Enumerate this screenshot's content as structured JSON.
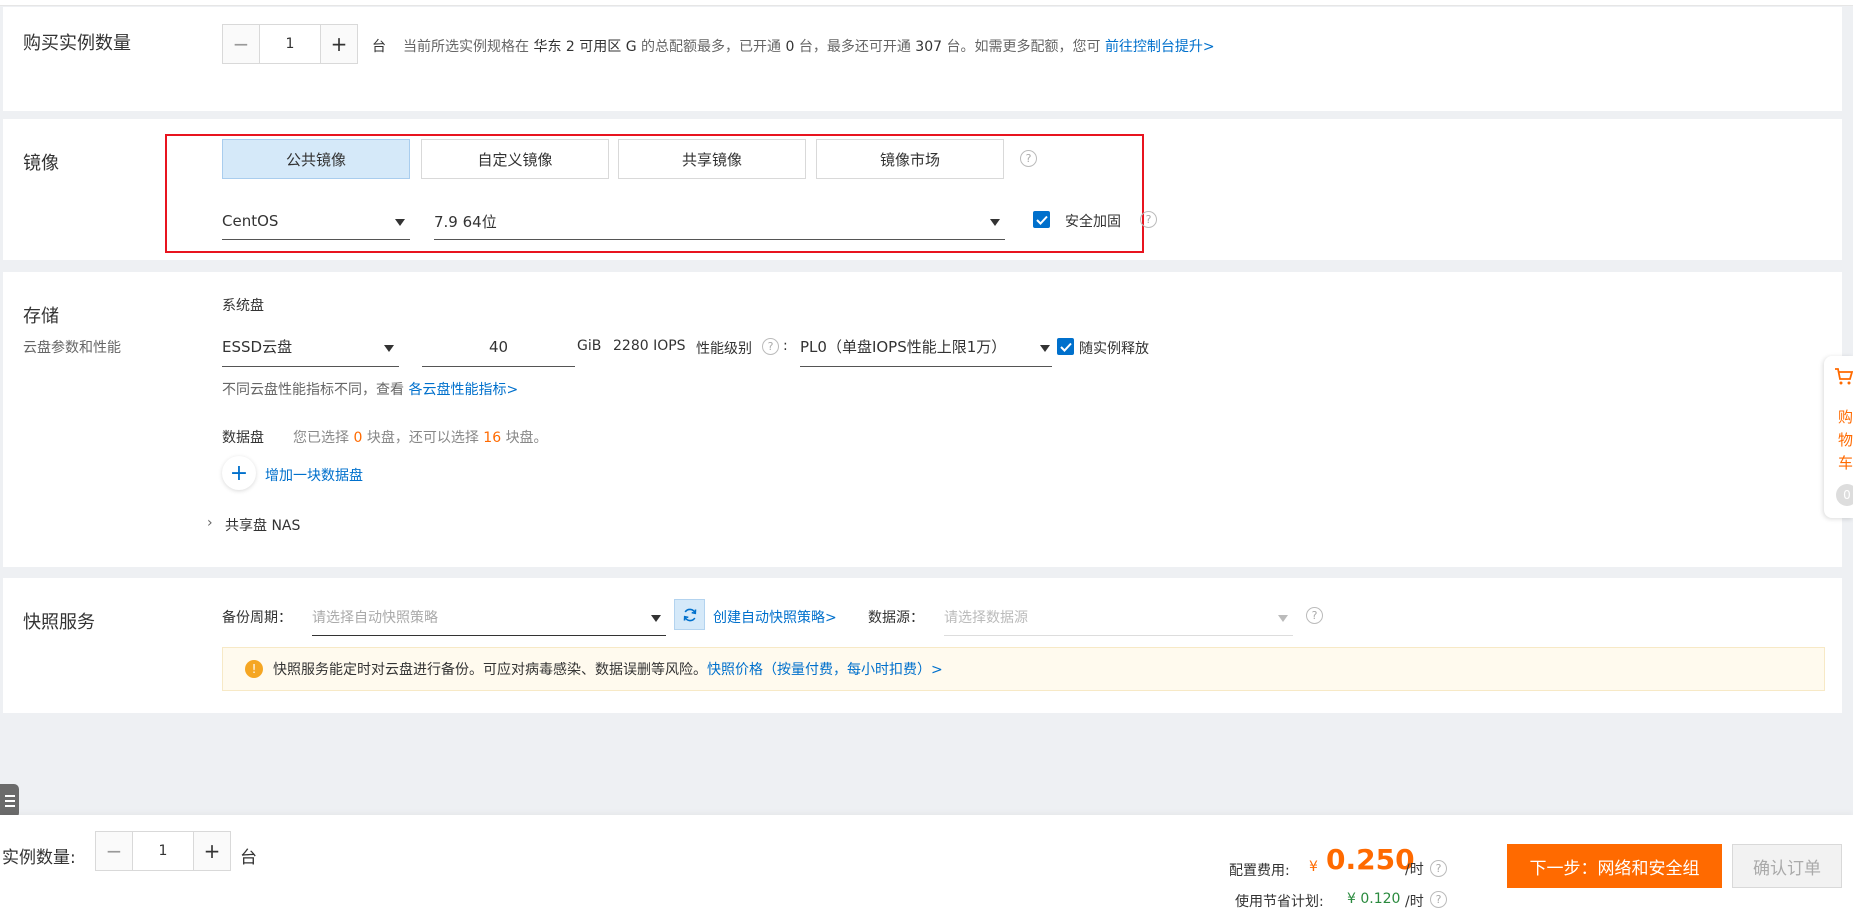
{
  "quantity_section": {
    "title": "购买实例数量",
    "value": "1",
    "unit": "台",
    "note_prefix": "当前所选实例规格在",
    "zone_strong": "华东 2 可用区 G",
    "note_middle": "的总配额最多，已开通",
    "opened": "0",
    "note_middle2": "台，最多还可开通",
    "remaining": "307",
    "note_suffix": "台。如需更多配额，您可",
    "link": "前往控制台提升>"
  },
  "image_section": {
    "title": "镜像",
    "tabs": [
      "公共镜像",
      "自定义镜像",
      "共享镜像",
      "镜像市场"
    ],
    "os": "CentOS",
    "version": "7.9 64位",
    "security_label": "安全加固"
  },
  "storage_section": {
    "title": "存储",
    "subtitle": "云盘参数和性能",
    "system_disk_label": "系统盘",
    "disk_type": "ESSD云盘",
    "disk_size": "40",
    "unit": "GiB",
    "iops": "2280 IOPS",
    "perf_level_label": "性能级别",
    "perf_level_colon": ":",
    "perf_level_value": "PL0（单盘IOPS性能上限1万）",
    "release_label": "随实例释放",
    "hint_text": "不同云盘性能指标不同，查看",
    "hint_link": "各云盘性能指标>",
    "data_disk_label": "数据盘",
    "data_note_1": "您已选择",
    "data_selected": "0",
    "data_note_2": "块盘，还可以选择",
    "data_remaining": "16",
    "data_note_3": "块盘。",
    "add_disk": "增加一块数据盘",
    "shared_nas": "共享盘 NAS"
  },
  "snapshot_section": {
    "title": "快照服务",
    "backup_label": "备份周期：",
    "backup_placeholder": "请选择自动快照策略",
    "create_link": "创建自动快照策略>",
    "source_label": "数据源：",
    "source_placeholder": "请选择数据源",
    "notice_text": "快照服务能定时对云盘进行备份。可应对病毒感染、数据误删等风险。",
    "notice_link": "快照价格（按量付费，每小时扣费）>"
  },
  "cart": {
    "label_chars": [
      "购",
      "物",
      "车"
    ],
    "count": "0"
  },
  "footer": {
    "quantity_label": "实例数量:",
    "quantity_value": "1",
    "unit": "台",
    "config_fee_label": "配置费用:",
    "currency": "¥",
    "price": "0.250",
    "per_hour": "/时",
    "saving_label": "使用节省计划:",
    "saving_price": "¥ 0.120",
    "saving_per_hour": "/时",
    "next_button": "下一步：网络和安全组",
    "confirm_button": "确认订单"
  },
  "colors": {
    "accent": "#0070cc",
    "orange": "#ff6a00",
    "highlight_border": "#e8141f"
  }
}
